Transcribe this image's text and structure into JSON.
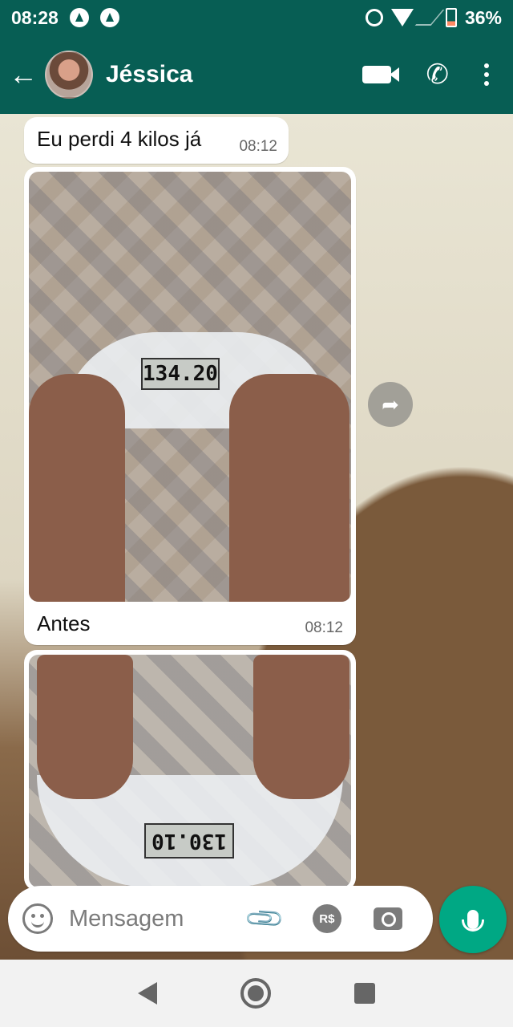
{
  "status_bar": {
    "time": "08:28",
    "battery": "36%"
  },
  "header": {
    "contact_name": "Jéssica"
  },
  "messages": [
    {
      "text": "Eu perdi 4 kilos já",
      "time": "08:12"
    },
    {
      "caption": "Antes",
      "time": "08:12",
      "scale_display": "134.20"
    },
    {
      "scale_display": "130.10"
    }
  ],
  "input": {
    "placeholder": "Mensagem",
    "currency_label": "R$"
  },
  "colors": {
    "header": "#075e54",
    "accent": "#00a884",
    "bubble": "#ffffff"
  },
  "icons": [
    "back-arrow-icon",
    "video-call-icon",
    "phone-icon",
    "menu-dots-icon",
    "forward-icon",
    "emoji-icon",
    "attach-icon",
    "payment-icon",
    "camera-icon",
    "mic-icon"
  ]
}
